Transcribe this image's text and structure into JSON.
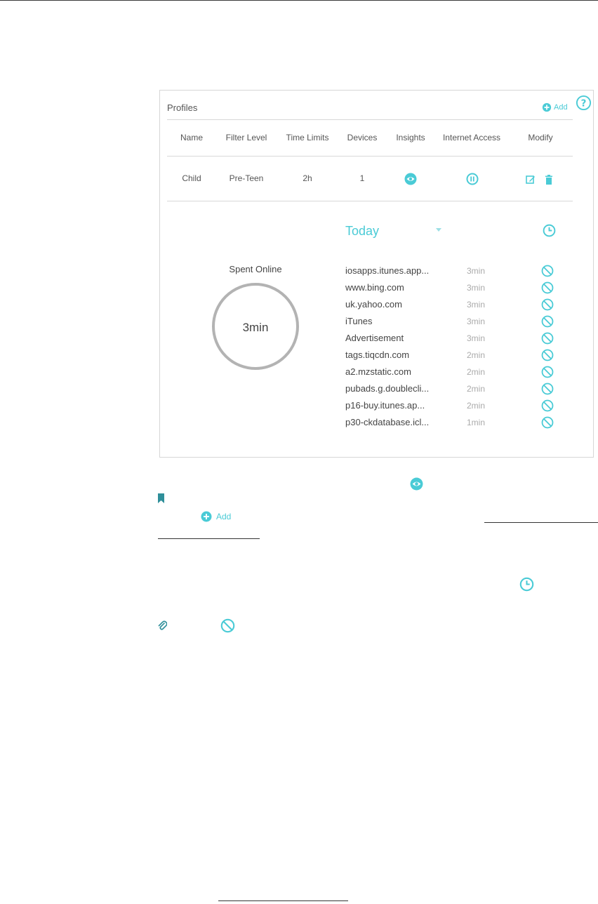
{
  "profiles": {
    "title": "Profiles",
    "add_label": "Add",
    "columns": [
      "Name",
      "Filter Level",
      "Time Limits",
      "Devices",
      "Insights",
      "Internet Access",
      "Modify"
    ],
    "rows": [
      {
        "name": "Child",
        "filter_level": "Pre-Teen",
        "time_limits": "2h",
        "devices": "1"
      }
    ]
  },
  "insights": {
    "period": "Today",
    "spent_label": "Spent Online",
    "spent_value": "3min",
    "sites": [
      {
        "site": "iosapps.itunes.app...",
        "time": "3min"
      },
      {
        "site": "www.bing.com",
        "time": "3min"
      },
      {
        "site": "uk.yahoo.com",
        "time": "3min"
      },
      {
        "site": "iTunes",
        "time": "3min"
      },
      {
        "site": "Advertisement",
        "time": "3min"
      },
      {
        "site": "tags.tiqcdn.com",
        "time": "2min"
      },
      {
        "site": "a2.mzstatic.com",
        "time": "2min"
      },
      {
        "site": "pubads.g.doublecli...",
        "time": "2min"
      },
      {
        "site": "p16-buy.itunes.ap...",
        "time": "2min"
      },
      {
        "site": "p30-ckdatabase.icl...",
        "time": "1min"
      }
    ]
  },
  "notes": {
    "add_label": "Add"
  },
  "colors": {
    "accent": "#4acbd6",
    "ring": "#b3b3b3"
  }
}
